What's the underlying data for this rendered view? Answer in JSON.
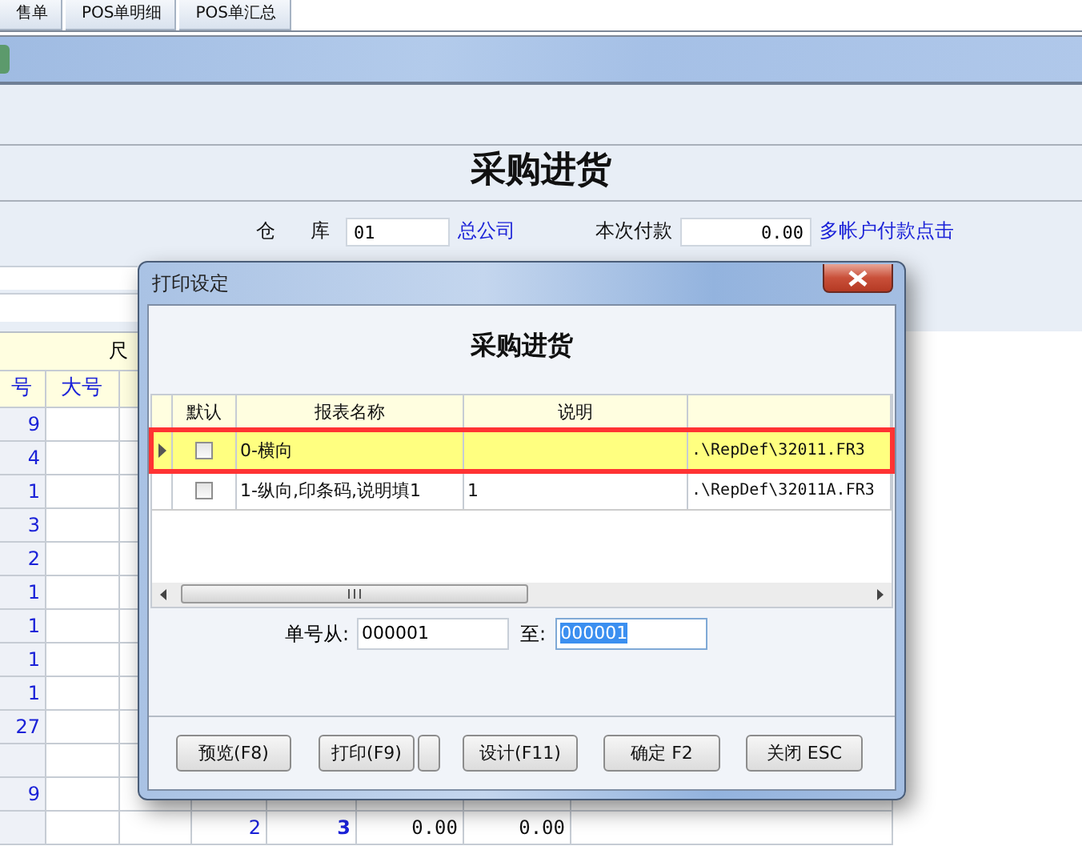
{
  "tabs": [
    {
      "label": "售单"
    },
    {
      "label": "POS单明细"
    },
    {
      "label": "POS单汇总"
    }
  ],
  "page_title": "采购进货",
  "form_fields": [
    {
      "label": "仓 库",
      "value": "01",
      "kind": "text",
      "link": "总公司"
    },
    {
      "label": "本次付款",
      "value": "0.00",
      "kind": "number",
      "link": "多帐户付款点击"
    }
  ],
  "grid": {
    "group_header": "尺",
    "columns": [
      "号",
      "大号"
    ],
    "rows": [
      {
        "column_1": "9"
      },
      {
        "column_1": "4"
      },
      {
        "column_1": "1"
      },
      {
        "column_1": "3"
      },
      {
        "column_1": "2"
      },
      {
        "column_1": "1"
      },
      {
        "column_1": "1"
      },
      {
        "column_1": "1"
      },
      {
        "column_1": "1"
      },
      {
        "column_1": "27"
      },
      {},
      {
        "column_1": "9"
      },
      {
        "column_4": "2",
        "column_5": "3",
        "column_6": "0.00",
        "column_7": "0.00"
      }
    ]
  },
  "dialog": {
    "title": "打印设定",
    "heading": "采购进货",
    "report_grid": {
      "columns": [
        "默认",
        "报表名称",
        "说明"
      ],
      "rows": [
        {
          "default": false,
          "name": "0-横向",
          "file": ".\\RepDef\\32011.FR3",
          "selected": true
        },
        {
          "default": false,
          "name": "1-纵向,印条码,说明填1",
          "note": "1",
          "file": ".\\RepDef\\32011A.FR3",
          "selected": false
        }
      ]
    },
    "range": {
      "from_label": "单号从:",
      "from_value": "000001",
      "to_label": "至:",
      "to_value": "000001",
      "to_text_selected": true
    },
    "buttons": [
      {
        "label": "预览(F8)",
        "kind": "plain"
      },
      {
        "label": "打印(F9)",
        "kind": "split"
      },
      {
        "label": "设计(F11)",
        "kind": "plain"
      },
      {
        "label": "确定 F2",
        "kind": "plain"
      },
      {
        "label": "关闭 ESC",
        "kind": "plain"
      }
    ]
  }
}
